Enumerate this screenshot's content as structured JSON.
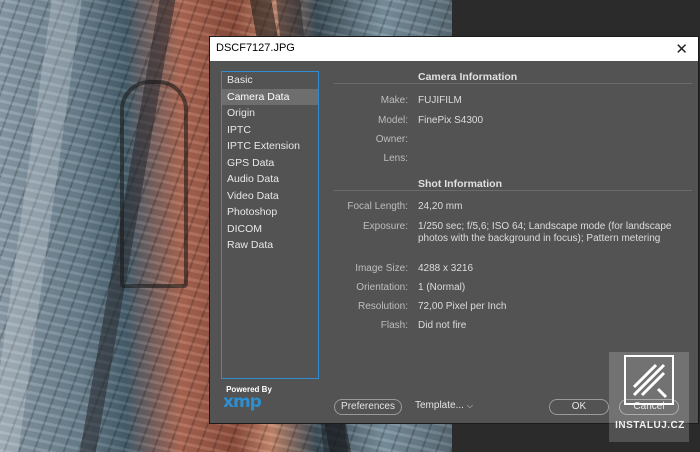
{
  "window": {
    "title": "DSCF7127.JPG",
    "close_glyph": "✕"
  },
  "nav": {
    "items": [
      {
        "label": "Basic"
      },
      {
        "label": "Camera Data"
      },
      {
        "label": "Origin"
      },
      {
        "label": "IPTC"
      },
      {
        "label": "IPTC Extension"
      },
      {
        "label": "GPS Data"
      },
      {
        "label": "Audio Data"
      },
      {
        "label": "Video Data"
      },
      {
        "label": "Photoshop"
      },
      {
        "label": "DICOM"
      },
      {
        "label": "Raw Data"
      }
    ],
    "selected": "Camera Data"
  },
  "branding": {
    "powered_by": "Powered By",
    "logo": "xmp"
  },
  "camera_info": {
    "heading": "Camera Information",
    "make_label": "Make:",
    "make": "FUJIFILM",
    "model_label": "Model:",
    "model": "FinePix S4300",
    "owner_label": "Owner:",
    "owner": "",
    "lens_label": "Lens:",
    "lens": ""
  },
  "shot_info": {
    "heading": "Shot Information",
    "focal_label": "Focal Length:",
    "focal": "24,20 mm",
    "exposure_label": "Exposure:",
    "exposure": "1/250 sec;  f/5,6;  ISO 64;  Landscape mode (for landscape photos with the background in focus);  Pattern metering",
    "size_label": "Image Size:",
    "size": "4288 x 3216",
    "orientation_label": "Orientation:",
    "orientation": "1 (Normal)",
    "resolution_label": "Resolution:",
    "resolution": "72,00 Pixel per Inch",
    "flash_label": "Flash:",
    "flash": "Did not fire"
  },
  "footer": {
    "preferences": "Preferences",
    "template": "Template...",
    "ok": "OK",
    "cancel": "Cancel"
  },
  "watermark": {
    "text": "INSTALUJ.CZ"
  },
  "colors": {
    "accent": "#2d8fd0",
    "dialog_bg": "#535353",
    "selected_bg": "#6e6e6e"
  }
}
